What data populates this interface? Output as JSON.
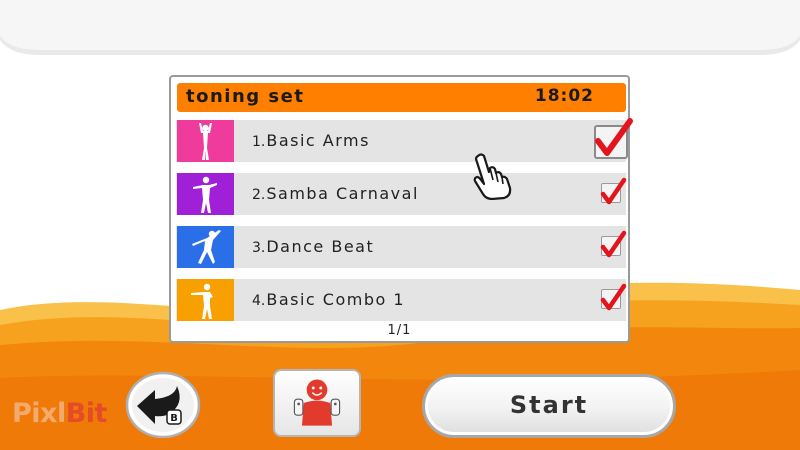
{
  "panel": {
    "title": "toning set",
    "time": "18:02",
    "pager": "1/1"
  },
  "exercises": [
    {
      "number": "1.",
      "name": "Basic Arms",
      "checked": true,
      "color": "#ee3b9c",
      "icon": "figure-arms-up-icon"
    },
    {
      "number": "2.",
      "name": "Samba Carnaval",
      "checked": true,
      "color": "#a020d8",
      "icon": "figure-samba-icon"
    },
    {
      "number": "3.",
      "name": "Dance Beat",
      "checked": true,
      "color": "#2b6fe8",
      "icon": "figure-dance-icon"
    },
    {
      "number": "4.",
      "name": "Basic Combo 1",
      "checked": true,
      "color": "#f7a000",
      "icon": "figure-combo-icon"
    }
  ],
  "buttons": {
    "back_badge": "B",
    "start": "Start"
  },
  "watermark": {
    "part1": "Pixl",
    "part2": "Bit"
  },
  "colors": {
    "accent": "#ff7f00",
    "check": "#e4141c"
  }
}
